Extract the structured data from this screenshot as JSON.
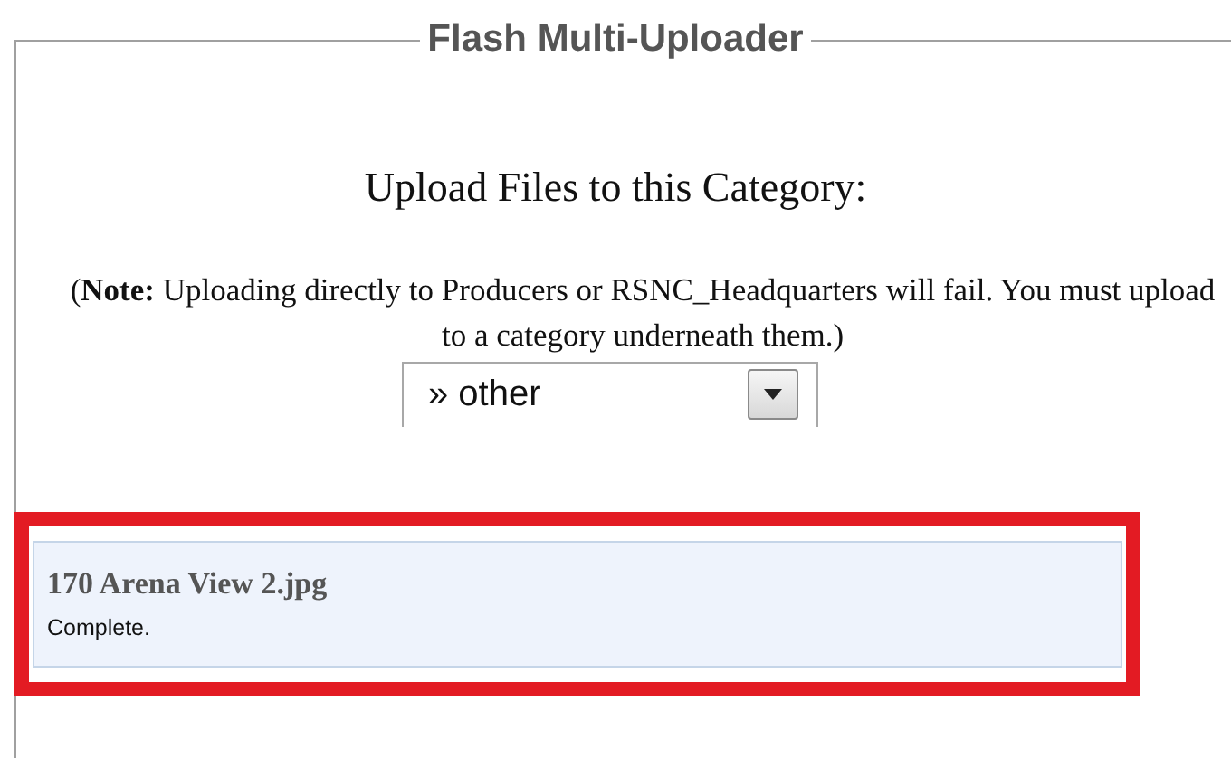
{
  "panel": {
    "title": "Flash Multi-Uploader"
  },
  "heading": "Upload Files to this Category:",
  "note": "(**Note:** Uploading directly to Producers or RSNC_Headquarters will fail. You must upload to a category underneath them.)",
  "category_select": {
    "value": "» other"
  },
  "files": [
    {
      "name": "170 Arena View 2.jpg",
      "status": "Complete.",
      "highlighted": true
    }
  ]
}
